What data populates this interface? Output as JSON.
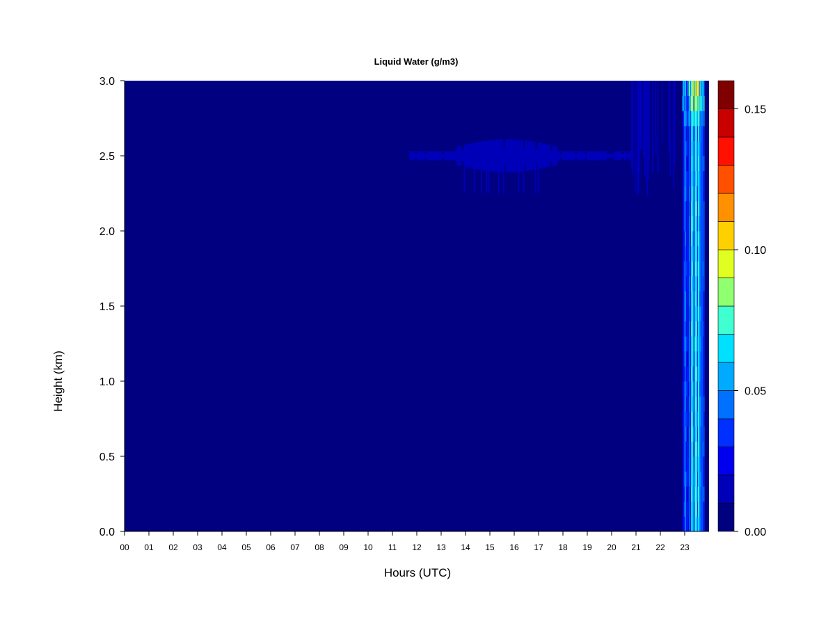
{
  "chart_data": {
    "type": "heatmap",
    "title": "Liquid Water (g/m3)",
    "xlabel": "Hours (UTC)",
    "ylabel": "Height (km)",
    "xlim": [
      0,
      24
    ],
    "ylim": [
      0,
      3.0
    ],
    "x_tick_labels": [
      "00",
      "01",
      "02",
      "03",
      "04",
      "05",
      "06",
      "07",
      "08",
      "09",
      "10",
      "11",
      "12",
      "13",
      "14",
      "15",
      "16",
      "17",
      "18",
      "19",
      "20",
      "21",
      "22",
      "23"
    ],
    "y_tick_labels": [
      "0.0",
      "0.5",
      "1.0",
      "1.5",
      "2.0",
      "2.5",
      "3.0"
    ],
    "colorbar": {
      "range": [
        0,
        0.16
      ],
      "levels": [
        0.0,
        0.01,
        0.02,
        0.03,
        0.04,
        0.05,
        0.06,
        0.07,
        0.08,
        0.09,
        0.1,
        0.11,
        0.12,
        0.13,
        0.14,
        0.15,
        0.16
      ],
      "colors": [
        "#000080",
        "#0000b8",
        "#0000ee",
        "#0030ff",
        "#0070ff",
        "#00aaff",
        "#00e0ff",
        "#40ffd0",
        "#90ff70",
        "#e0ff20",
        "#ffd000",
        "#ff9000",
        "#ff5000",
        "#ff1000",
        "#c80000",
        "#800000"
      ],
      "tick_labels": [
        "0.00",
        "0.05",
        "0.10",
        "0.15"
      ]
    },
    "features": [
      {
        "kind": "cloud_layer",
        "x_range": [
          11.7,
          20.8
        ],
        "height_km": 2.5,
        "value": 0.01
      },
      {
        "kind": "cloud_patch",
        "x_range": [
          20.8,
          22.6
        ],
        "y_range": [
          2.2,
          3.0
        ],
        "value": 0.01
      },
      {
        "kind": "precipitation",
        "x_range": [
          22.9,
          23.8
        ],
        "y_range": [
          0.0,
          3.0
        ],
        "value_max": 0.11
      }
    ]
  }
}
